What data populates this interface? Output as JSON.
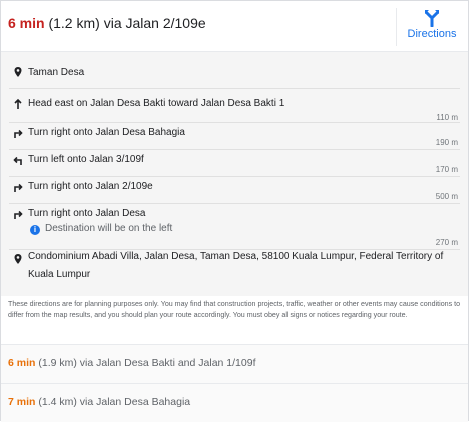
{
  "main_route": {
    "time": "6 min",
    "distance": "(1.2 km)",
    "via": "via Jalan 2/109e"
  },
  "directions_button": {
    "label": "Directions",
    "icon": "directions-fork-icon"
  },
  "steps": {
    "origin": "Taman Desa",
    "items": [
      {
        "icon": "arrow-up-icon",
        "text": "Head east on Jalan Desa Bakti toward Jalan Desa Bakti 1",
        "distance": "110 m"
      },
      {
        "icon": "turn-right-icon",
        "text": "Turn right onto Jalan Desa Bahagia",
        "distance": "190 m"
      },
      {
        "icon": "turn-left-icon",
        "text": "Turn left onto Jalan 3/109f",
        "distance": "170 m"
      },
      {
        "icon": "turn-right-icon",
        "text": "Turn right onto Jalan 2/109e",
        "distance": "500 m"
      },
      {
        "icon": "turn-right-icon",
        "text": "Turn right onto Jalan Desa",
        "distance": "270 m",
        "note": "Destination will be on the left"
      }
    ],
    "destination_line1": "Condominium Abadi Villa, Jalan Desa, Taman Desa, 58100 Kuala Lumpur, Federal Territory of",
    "destination_line2": "Kuala Lumpur"
  },
  "disclaimer": "These directions are for planning purposes only. You may find that construction projects, traffic, weather or other events may cause conditions to differ from the map results, and you should plan your route accordingly. You must obey all signs or notices regarding your route.",
  "alternatives": [
    {
      "time": "6 min",
      "distance": "(1.9 km)",
      "via": "via Jalan Desa Bakti and Jalan 1/109f"
    },
    {
      "time": "7 min",
      "distance": "(1.4 km)",
      "via": "via Jalan Desa Bahagia"
    }
  ],
  "colors": {
    "main_time": "#c5221f",
    "alt_time": "#e8710a",
    "link": "#1a73e8",
    "steps_bg": "#f5f5f5"
  }
}
